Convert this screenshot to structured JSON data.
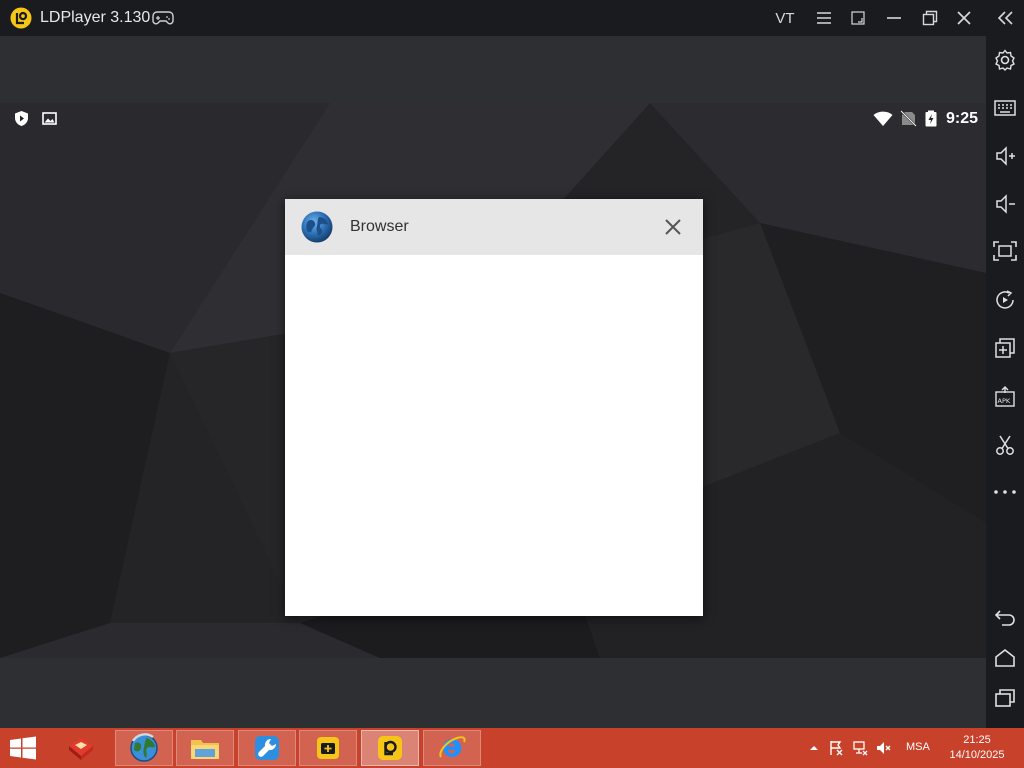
{
  "window": {
    "title": "LDPlayer 3.130",
    "vt_label": "VT",
    "icons": [
      "ldplayer-logo",
      "gamepad-icon",
      "menu-icon",
      "resize-icon",
      "minimize-icon",
      "restore-icon",
      "close-icon",
      "collapse-sidebar-icon"
    ]
  },
  "statusbar": {
    "time": "9:25",
    "left_icons": [
      "shield-play-icon",
      "image-icon"
    ],
    "right_icons": [
      "wifi-icon",
      "no-sim-icon",
      "battery-charging-icon"
    ]
  },
  "dialog": {
    "app_name": "Browser",
    "app_icon": "globe-icon",
    "close_icon": "close-icon"
  },
  "sidebar": {
    "items": [
      {
        "name": "settings",
        "icon": "gear-icon"
      },
      {
        "name": "keyboard",
        "icon": "keyboard-icon"
      },
      {
        "name": "volume-up",
        "icon": "volume-up-icon"
      },
      {
        "name": "volume-down",
        "icon": "volume-down-icon"
      },
      {
        "name": "fullscreen",
        "icon": "fullscreen-icon"
      },
      {
        "name": "rotate",
        "icon": "rotate-icon"
      },
      {
        "name": "multi-instance",
        "icon": "add-window-icon"
      },
      {
        "name": "install-apk",
        "icon": "apk-icon"
      },
      {
        "name": "screenshot",
        "icon": "scissors-icon"
      },
      {
        "name": "more",
        "icon": "more-icon"
      },
      {
        "name": "back",
        "icon": "back-icon"
      },
      {
        "name": "home",
        "icon": "home-icon"
      },
      {
        "name": "recents",
        "icon": "recents-icon"
      }
    ]
  },
  "taskbar": {
    "lang": "MSA",
    "time": "21:25",
    "date": "14/10/2025",
    "tasks": [
      "app-red-icon",
      "browser-globe-icon",
      "file-explorer-icon",
      "tools-icon",
      "ldmultiplayer-icon",
      "ldplayer-icon",
      "internet-explorer-icon"
    ],
    "tray_icons": [
      "chevron-up-icon",
      "flag-icon",
      "network-icon",
      "volume-muted-icon"
    ]
  },
  "colors": {
    "titlebar": "#1a1b1f",
    "toolbar_strip": "#2e2f33",
    "dialog_header": "#e6e6e6",
    "taskbar": "#c8412b",
    "accent_yellow": "#f5c518"
  }
}
